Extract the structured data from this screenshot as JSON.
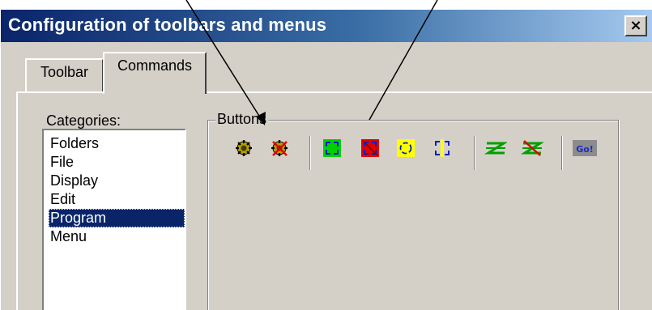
{
  "window": {
    "title": "Configuration of toolbars and menus",
    "close_glyph": "×"
  },
  "tabs": [
    {
      "label": "Toolbar",
      "active": false
    },
    {
      "label": "Commands",
      "active": true
    }
  ],
  "categories": {
    "label": "Categories:",
    "items": [
      "Folders",
      "File",
      "Display",
      "Edit",
      "Program",
      "Menu"
    ],
    "selected": "Program"
  },
  "buttons_group": {
    "label": "Buttons",
    "icons": [
      {
        "name": "gear-icon",
        "color": "#e0c000"
      },
      {
        "name": "gear-delete-icon",
        "color": "#e0c000"
      },
      {
        "name": "green-arrows-icon",
        "color": "#00c000"
      },
      {
        "name": "red-arrows-icon",
        "color": "#e00000"
      },
      {
        "name": "yellow-circle-arrows-icon",
        "color": "#f0f000"
      },
      {
        "name": "blue-arrows-icon",
        "color": "#ffff00"
      },
      {
        "name": "green-z-icon",
        "color": "#00a000"
      },
      {
        "name": "green-z-strike-icon",
        "color": "#00a000"
      },
      {
        "name": "go-icon",
        "label": "Go!"
      }
    ]
  },
  "colors": {
    "title_bar_start": "#0a246a",
    "title_bar_end": "#a6caf0",
    "selection": "#0a246a",
    "dialog_face": "#d4d0c8"
  }
}
